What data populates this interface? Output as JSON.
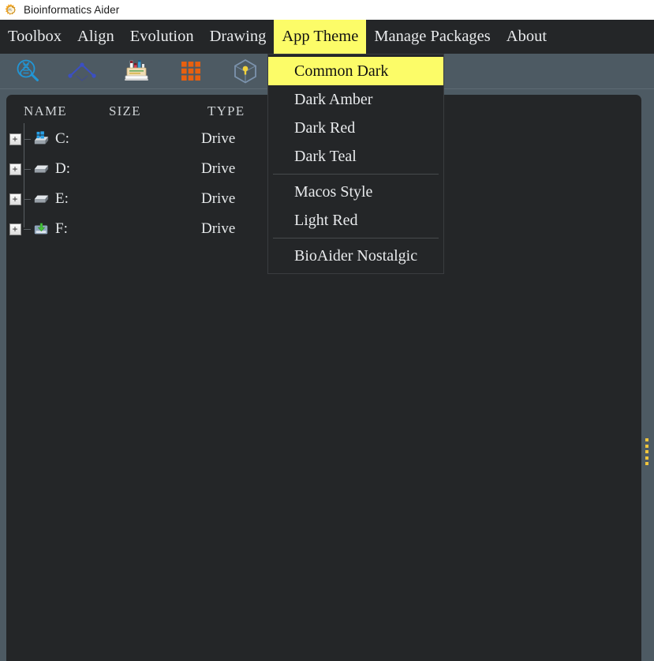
{
  "window": {
    "title": "Bioinformatics Aider",
    "logo_icon": "bioaider-sun-logo-icon"
  },
  "menubar": {
    "items": [
      {
        "label": "Toolbox",
        "active": false
      },
      {
        "label": "Align",
        "active": false
      },
      {
        "label": "Evolution",
        "active": false
      },
      {
        "label": "Drawing",
        "active": false
      },
      {
        "label": "App Theme",
        "active": true
      },
      {
        "label": "Manage Packages",
        "active": false
      },
      {
        "label": "About",
        "active": false
      }
    ],
    "active_color": "#fcfc68",
    "bar_color": "#242628",
    "text_color": "#e8eaec"
  },
  "toolbar": {
    "buttons": [
      {
        "icon": "dna-search-icon",
        "color": "#2196d6"
      },
      {
        "icon": "phylogenetic-tree-icon",
        "color": "#3b4fc4"
      },
      {
        "icon": "drawing-tools-icon",
        "color": "#e8d8b8"
      },
      {
        "icon": "grid-matrix-icon",
        "color": "#e8600f"
      },
      {
        "icon": "package-cube-icon",
        "color": "#7c93ad"
      }
    ]
  },
  "theme_menu": {
    "items": [
      {
        "label": "Common Dark",
        "selected": true,
        "separator_after": false
      },
      {
        "label": "Dark Amber",
        "selected": false,
        "separator_after": false
      },
      {
        "label": "Dark Red",
        "selected": false,
        "separator_after": false
      },
      {
        "label": "Dark Teal",
        "selected": false,
        "separator_after": true
      },
      {
        "label": "Macos Style",
        "selected": false,
        "separator_after": false
      },
      {
        "label": "Light Red",
        "selected": false,
        "separator_after": true
      },
      {
        "label": "BioAider Nostalgic",
        "selected": false,
        "separator_after": false
      }
    ],
    "highlight_color": "#fcfc68",
    "background_color": "#242628"
  },
  "file_tree": {
    "columns": [
      "NAME",
      "SIZE",
      "TYPE"
    ],
    "rows": [
      {
        "expander": "+",
        "icon": "windows-drive-icon",
        "name": "C:",
        "size": "",
        "type": "Drive"
      },
      {
        "expander": "+",
        "icon": "hard-drive-icon",
        "name": "D:",
        "size": "",
        "type": "Drive"
      },
      {
        "expander": "+",
        "icon": "hard-drive-icon",
        "name": "E:",
        "size": "",
        "type": "Drive"
      },
      {
        "expander": "+",
        "icon": "removable-drive-icon",
        "name": "F:",
        "size": "",
        "type": "Drive"
      }
    ],
    "panel_color": "#242628"
  },
  "splitter": {
    "handle_icon": "vertical-splitter-dots-icon",
    "dot_color": "#f0c53c",
    "dot_count": 5
  }
}
